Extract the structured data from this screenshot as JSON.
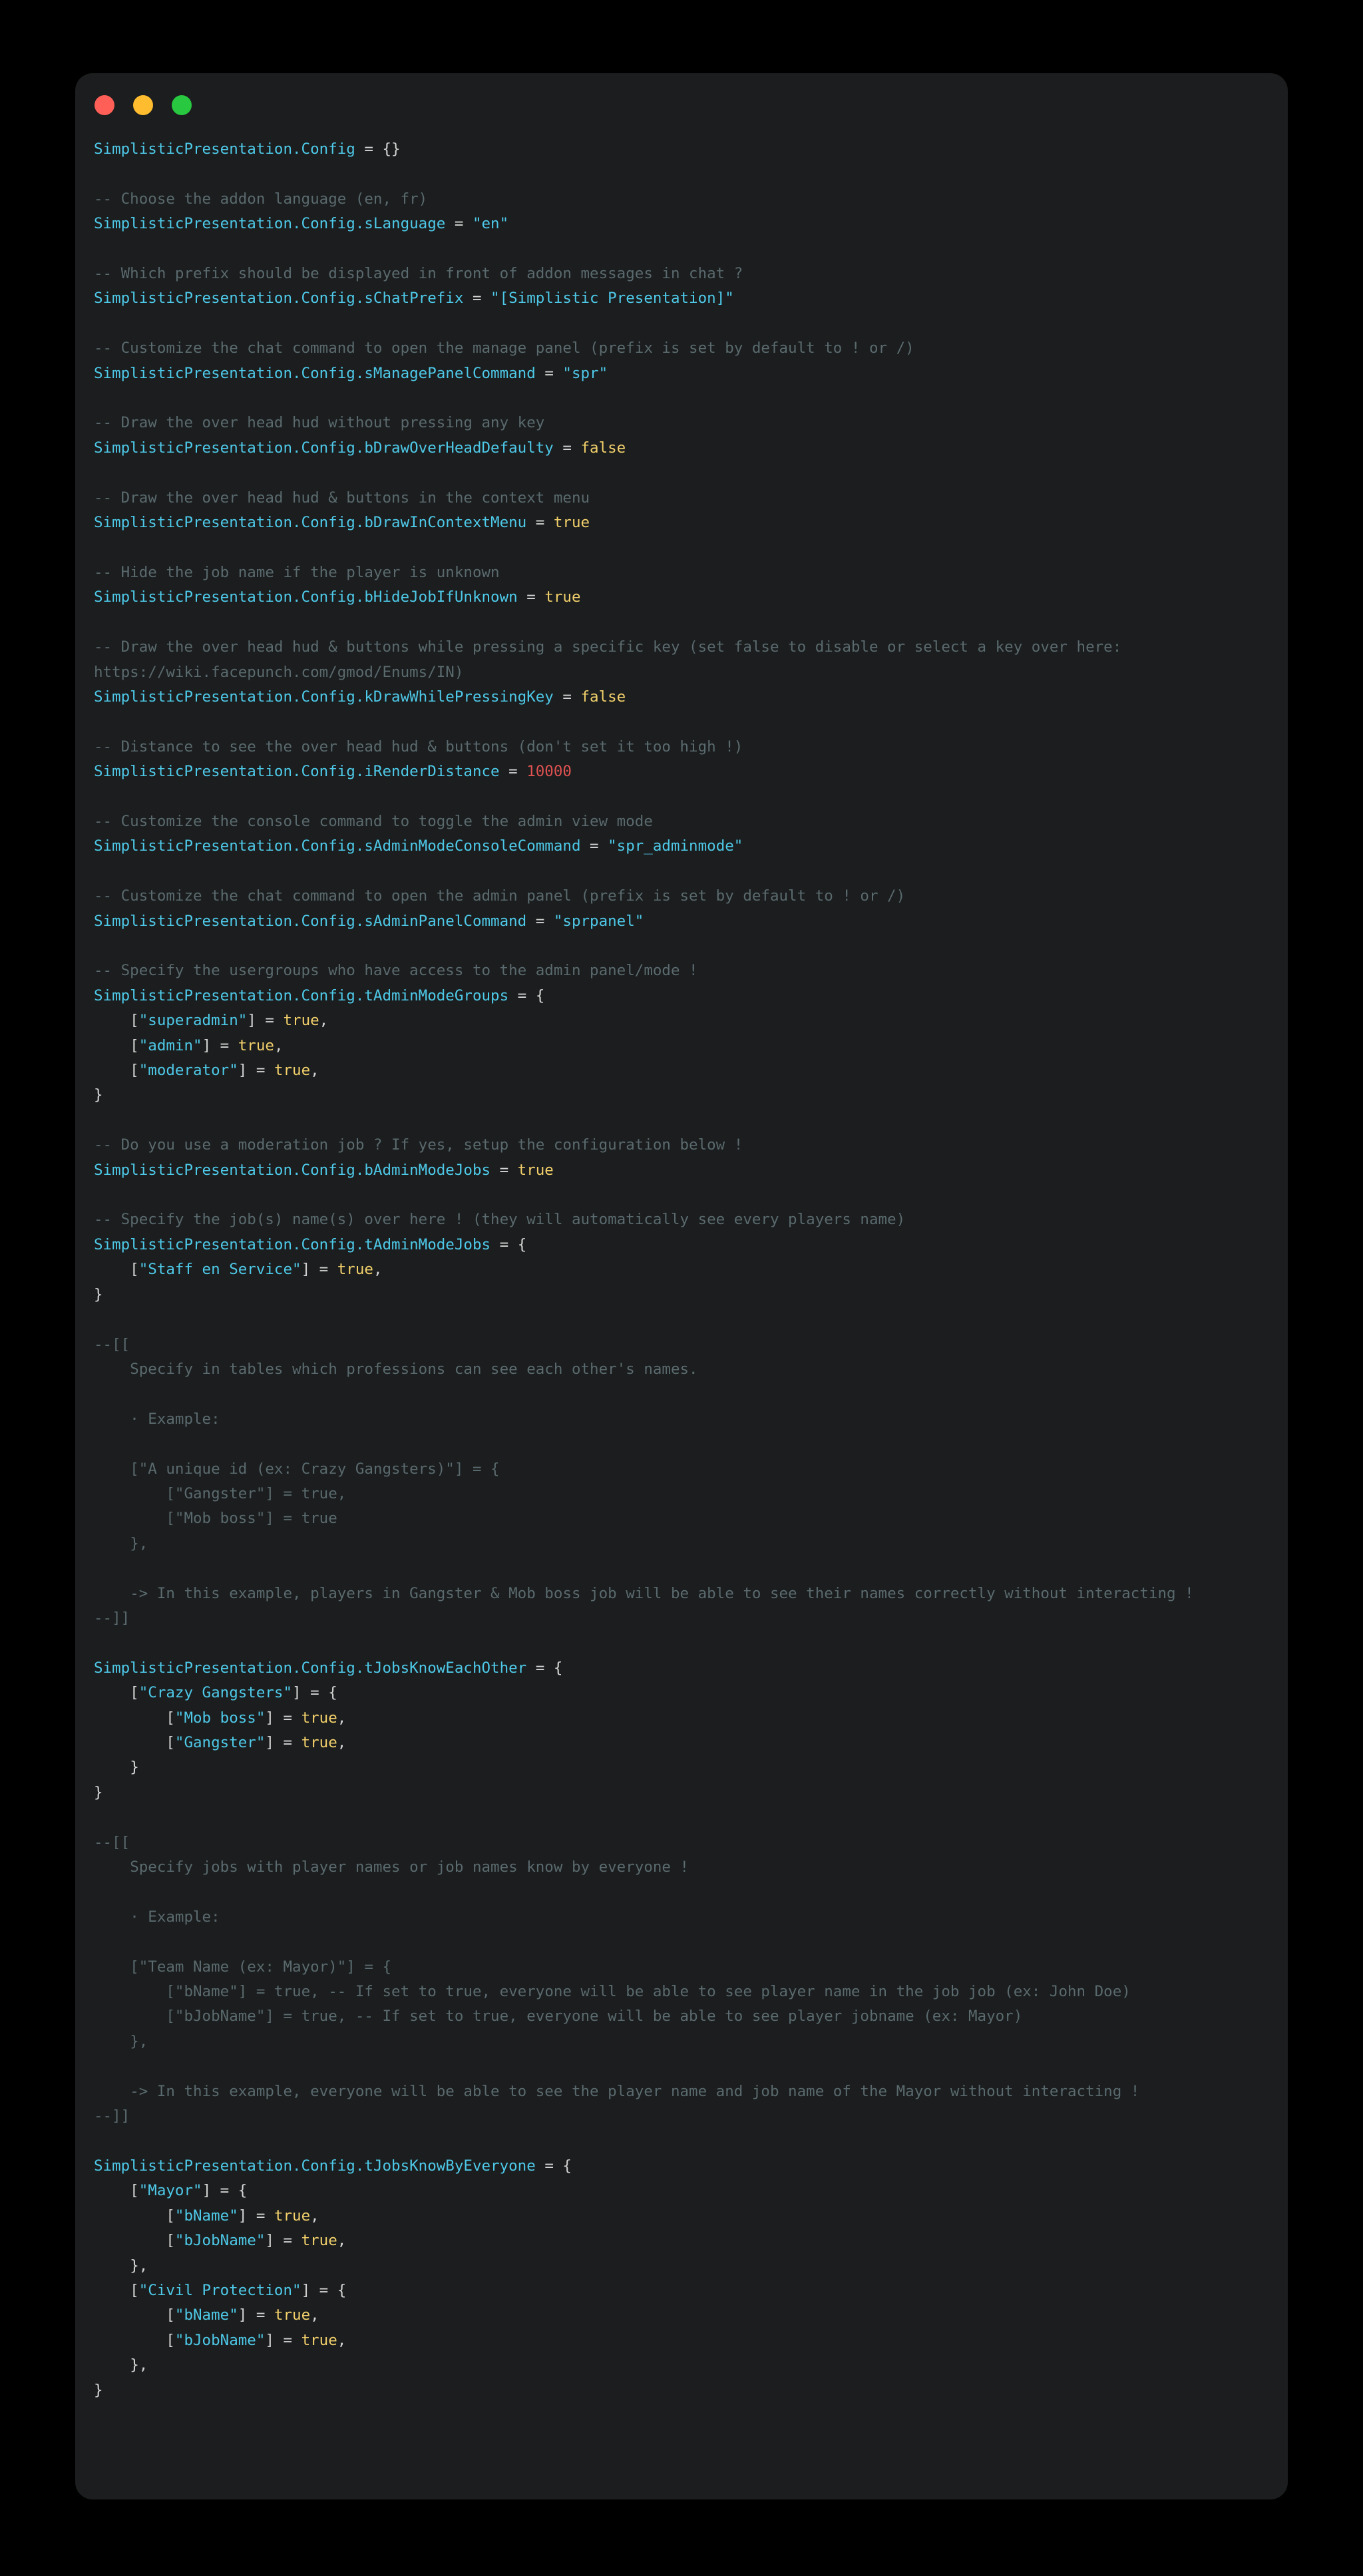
{
  "window": {
    "traffic_lights": [
      {
        "name": "close-button",
        "color": "#ff5f57"
      },
      {
        "name": "minimize-button",
        "color": "#febc2e"
      },
      {
        "name": "maximize-button",
        "color": "#28c840"
      }
    ],
    "background": "#1b1d1e",
    "page_background": "#000000"
  },
  "theme": {
    "identifier": "#4ec9e8",
    "string": "#4ec9e8",
    "boolean": "#f2d06b",
    "number": "#e05252",
    "punctuation": "#d4d4d4",
    "comment": "#5a6a6e"
  },
  "code": {
    "language": "lua",
    "lines": [
      [
        {
          "t": "ident",
          "v": "SimplisticPresentation.Config"
        },
        {
          "t": "plain",
          "v": " "
        },
        {
          "t": "op",
          "v": "="
        },
        {
          "t": "plain",
          "v": " "
        },
        {
          "t": "punct",
          "v": "{}"
        }
      ],
      [],
      [
        {
          "t": "comment",
          "v": "-- Choose the addon language (en, fr)"
        }
      ],
      [
        {
          "t": "ident",
          "v": "SimplisticPresentation.Config.sLanguage"
        },
        {
          "t": "plain",
          "v": " "
        },
        {
          "t": "op",
          "v": "="
        },
        {
          "t": "plain",
          "v": " "
        },
        {
          "t": "str",
          "v": "\"en\""
        }
      ],
      [],
      [
        {
          "t": "comment",
          "v": "-- Which prefix should be displayed in front of addon messages in chat ?"
        }
      ],
      [
        {
          "t": "ident",
          "v": "SimplisticPresentation.Config.sChatPrefix"
        },
        {
          "t": "plain",
          "v": " "
        },
        {
          "t": "op",
          "v": "="
        },
        {
          "t": "plain",
          "v": " "
        },
        {
          "t": "str",
          "v": "\"[Simplistic Presentation]\""
        }
      ],
      [],
      [
        {
          "t": "comment",
          "v": "-- Customize the chat command to open the manage panel (prefix is set by default to ! or /)"
        }
      ],
      [
        {
          "t": "ident",
          "v": "SimplisticPresentation.Config.sManagePanelCommand"
        },
        {
          "t": "plain",
          "v": " "
        },
        {
          "t": "op",
          "v": "="
        },
        {
          "t": "plain",
          "v": " "
        },
        {
          "t": "str",
          "v": "\"spr\""
        }
      ],
      [],
      [
        {
          "t": "comment",
          "v": "-- Draw the over head hud without pressing any key"
        }
      ],
      [
        {
          "t": "ident",
          "v": "SimplisticPresentation.Config.bDrawOverHeadDefaulty"
        },
        {
          "t": "plain",
          "v": " "
        },
        {
          "t": "op",
          "v": "="
        },
        {
          "t": "plain",
          "v": " "
        },
        {
          "t": "bool",
          "v": "false"
        }
      ],
      [],
      [
        {
          "t": "comment",
          "v": "-- Draw the over head hud & buttons in the context menu"
        }
      ],
      [
        {
          "t": "ident",
          "v": "SimplisticPresentation.Config.bDrawInContextMenu"
        },
        {
          "t": "plain",
          "v": " "
        },
        {
          "t": "op",
          "v": "="
        },
        {
          "t": "plain",
          "v": " "
        },
        {
          "t": "bool",
          "v": "true"
        }
      ],
      [],
      [
        {
          "t": "comment",
          "v": "-- Hide the job name if the player is unknown"
        }
      ],
      [
        {
          "t": "ident",
          "v": "SimplisticPresentation.Config.bHideJobIfUnknown"
        },
        {
          "t": "plain",
          "v": " "
        },
        {
          "t": "op",
          "v": "="
        },
        {
          "t": "plain",
          "v": " "
        },
        {
          "t": "bool",
          "v": "true"
        }
      ],
      [],
      [
        {
          "t": "comment",
          "v": "-- Draw the over head hud & buttons while pressing a specific key (set false to disable or select a key over here: https://wiki.facepunch.com/gmod/Enums/IN)"
        }
      ],
      [
        {
          "t": "ident",
          "v": "SimplisticPresentation.Config.kDrawWhilePressingKey"
        },
        {
          "t": "plain",
          "v": " "
        },
        {
          "t": "op",
          "v": "="
        },
        {
          "t": "plain",
          "v": " "
        },
        {
          "t": "bool",
          "v": "false"
        }
      ],
      [],
      [
        {
          "t": "comment",
          "v": "-- Distance to see the over head hud & buttons (don't set it too high !)"
        }
      ],
      [
        {
          "t": "ident",
          "v": "SimplisticPresentation.Config.iRenderDistance"
        },
        {
          "t": "plain",
          "v": " "
        },
        {
          "t": "op",
          "v": "="
        },
        {
          "t": "plain",
          "v": " "
        },
        {
          "t": "num",
          "v": "10000"
        }
      ],
      [],
      [
        {
          "t": "comment",
          "v": "-- Customize the console command to toggle the admin view mode"
        }
      ],
      [
        {
          "t": "ident",
          "v": "SimplisticPresentation.Config.sAdminModeConsoleCommand"
        },
        {
          "t": "plain",
          "v": " "
        },
        {
          "t": "op",
          "v": "="
        },
        {
          "t": "plain",
          "v": " "
        },
        {
          "t": "str",
          "v": "\"spr_adminmode\""
        }
      ],
      [],
      [
        {
          "t": "comment",
          "v": "-- Customize the chat command to open the admin panel (prefix is set by default to ! or /)"
        }
      ],
      [
        {
          "t": "ident",
          "v": "SimplisticPresentation.Config.sAdminPanelCommand"
        },
        {
          "t": "plain",
          "v": " "
        },
        {
          "t": "op",
          "v": "="
        },
        {
          "t": "plain",
          "v": " "
        },
        {
          "t": "str",
          "v": "\"sprpanel\""
        }
      ],
      [],
      [
        {
          "t": "comment",
          "v": "-- Specify the usergroups who have access to the admin panel/mode !"
        }
      ],
      [
        {
          "t": "ident",
          "v": "SimplisticPresentation.Config.tAdminModeGroups"
        },
        {
          "t": "plain",
          "v": " "
        },
        {
          "t": "op",
          "v": "="
        },
        {
          "t": "plain",
          "v": " "
        },
        {
          "t": "punct",
          "v": "{"
        }
      ],
      [
        {
          "t": "plain",
          "v": "    "
        },
        {
          "t": "punct",
          "v": "["
        },
        {
          "t": "str",
          "v": "\"superadmin\""
        },
        {
          "t": "punct",
          "v": "]"
        },
        {
          "t": "plain",
          "v": " "
        },
        {
          "t": "op",
          "v": "="
        },
        {
          "t": "plain",
          "v": " "
        },
        {
          "t": "bool",
          "v": "true"
        },
        {
          "t": "punct",
          "v": ","
        }
      ],
      [
        {
          "t": "plain",
          "v": "    "
        },
        {
          "t": "punct",
          "v": "["
        },
        {
          "t": "str",
          "v": "\"admin\""
        },
        {
          "t": "punct",
          "v": "]"
        },
        {
          "t": "plain",
          "v": " "
        },
        {
          "t": "op",
          "v": "="
        },
        {
          "t": "plain",
          "v": " "
        },
        {
          "t": "bool",
          "v": "true"
        },
        {
          "t": "punct",
          "v": ","
        }
      ],
      [
        {
          "t": "plain",
          "v": "    "
        },
        {
          "t": "punct",
          "v": "["
        },
        {
          "t": "str",
          "v": "\"moderator\""
        },
        {
          "t": "punct",
          "v": "]"
        },
        {
          "t": "plain",
          "v": " "
        },
        {
          "t": "op",
          "v": "="
        },
        {
          "t": "plain",
          "v": " "
        },
        {
          "t": "bool",
          "v": "true"
        },
        {
          "t": "punct",
          "v": ","
        }
      ],
      [
        {
          "t": "punct",
          "v": "}"
        }
      ],
      [],
      [
        {
          "t": "comment",
          "v": "-- Do you use a moderation job ? If yes, setup the configuration below !"
        }
      ],
      [
        {
          "t": "ident",
          "v": "SimplisticPresentation.Config.bAdminModeJobs"
        },
        {
          "t": "plain",
          "v": " "
        },
        {
          "t": "op",
          "v": "="
        },
        {
          "t": "plain",
          "v": " "
        },
        {
          "t": "bool",
          "v": "true"
        }
      ],
      [],
      [
        {
          "t": "comment",
          "v": "-- Specify the job(s) name(s) over here ! (they will automatically see every players name)"
        }
      ],
      [
        {
          "t": "ident",
          "v": "SimplisticPresentation.Config.tAdminModeJobs"
        },
        {
          "t": "plain",
          "v": " "
        },
        {
          "t": "op",
          "v": "="
        },
        {
          "t": "plain",
          "v": " "
        },
        {
          "t": "punct",
          "v": "{"
        }
      ],
      [
        {
          "t": "plain",
          "v": "    "
        },
        {
          "t": "punct",
          "v": "["
        },
        {
          "t": "str",
          "v": "\"Staff en Service\""
        },
        {
          "t": "punct",
          "v": "]"
        },
        {
          "t": "plain",
          "v": " "
        },
        {
          "t": "op",
          "v": "="
        },
        {
          "t": "plain",
          "v": " "
        },
        {
          "t": "bool",
          "v": "true"
        },
        {
          "t": "punct",
          "v": ","
        }
      ],
      [
        {
          "t": "punct",
          "v": "}"
        }
      ],
      [],
      [
        {
          "t": "comment",
          "v": "--[["
        }
      ],
      [
        {
          "t": "comment",
          "v": "    Specify in tables which professions can see each other's names."
        }
      ],
      [],
      [
        {
          "t": "comment",
          "v": "    · Example:"
        }
      ],
      [],
      [
        {
          "t": "comment",
          "v": "    [\"A unique id (ex: Crazy Gangsters)\"] = {"
        }
      ],
      [
        {
          "t": "comment",
          "v": "        [\"Gangster\"] = true,"
        }
      ],
      [
        {
          "t": "comment",
          "v": "        [\"Mob boss\"] = true"
        }
      ],
      [
        {
          "t": "comment",
          "v": "    },"
        }
      ],
      [],
      [
        {
          "t": "comment",
          "v": "    -> In this example, players in Gangster & Mob boss job will be able to see their names correctly without interacting !"
        }
      ],
      [
        {
          "t": "comment",
          "v": "--]]"
        }
      ],
      [],
      [
        {
          "t": "ident",
          "v": "SimplisticPresentation.Config.tJobsKnowEachOther"
        },
        {
          "t": "plain",
          "v": " "
        },
        {
          "t": "op",
          "v": "="
        },
        {
          "t": "plain",
          "v": " "
        },
        {
          "t": "punct",
          "v": "{"
        }
      ],
      [
        {
          "t": "plain",
          "v": "    "
        },
        {
          "t": "punct",
          "v": "["
        },
        {
          "t": "str",
          "v": "\"Crazy Gangsters\""
        },
        {
          "t": "punct",
          "v": "]"
        },
        {
          "t": "plain",
          "v": " "
        },
        {
          "t": "op",
          "v": "="
        },
        {
          "t": "plain",
          "v": " "
        },
        {
          "t": "punct",
          "v": "{"
        }
      ],
      [
        {
          "t": "plain",
          "v": "        "
        },
        {
          "t": "punct",
          "v": "["
        },
        {
          "t": "str",
          "v": "\"Mob boss\""
        },
        {
          "t": "punct",
          "v": "]"
        },
        {
          "t": "plain",
          "v": " "
        },
        {
          "t": "op",
          "v": "="
        },
        {
          "t": "plain",
          "v": " "
        },
        {
          "t": "bool",
          "v": "true"
        },
        {
          "t": "punct",
          "v": ","
        }
      ],
      [
        {
          "t": "plain",
          "v": "        "
        },
        {
          "t": "punct",
          "v": "["
        },
        {
          "t": "str",
          "v": "\"Gangster\""
        },
        {
          "t": "punct",
          "v": "]"
        },
        {
          "t": "plain",
          "v": " "
        },
        {
          "t": "op",
          "v": "="
        },
        {
          "t": "plain",
          "v": " "
        },
        {
          "t": "bool",
          "v": "true"
        },
        {
          "t": "punct",
          "v": ","
        }
      ],
      [
        {
          "t": "plain",
          "v": "    "
        },
        {
          "t": "punct",
          "v": "}"
        }
      ],
      [
        {
          "t": "punct",
          "v": "}"
        }
      ],
      [],
      [
        {
          "t": "comment",
          "v": "--[["
        }
      ],
      [
        {
          "t": "comment",
          "v": "    Specify jobs with player names or job names know by everyone !"
        }
      ],
      [],
      [
        {
          "t": "comment",
          "v": "    · Example:"
        }
      ],
      [],
      [
        {
          "t": "comment",
          "v": "    [\"Team Name (ex: Mayor)\"] = {"
        }
      ],
      [
        {
          "t": "comment",
          "v": "        [\"bName\"] = true, -- If set to true, everyone will be able to see player name in the job job (ex: John Doe)"
        }
      ],
      [
        {
          "t": "comment",
          "v": "        [\"bJobName\"] = true, -- If set to true, everyone will be able to see player jobname (ex: Mayor)"
        }
      ],
      [
        {
          "t": "comment",
          "v": "    },"
        }
      ],
      [],
      [
        {
          "t": "comment",
          "v": "    -> In this example, everyone will be able to see the player name and job name of the Mayor without interacting !"
        }
      ],
      [
        {
          "t": "comment",
          "v": "--]]"
        }
      ],
      [],
      [
        {
          "t": "ident",
          "v": "SimplisticPresentation.Config.tJobsKnowByEveryone"
        },
        {
          "t": "plain",
          "v": " "
        },
        {
          "t": "op",
          "v": "="
        },
        {
          "t": "plain",
          "v": " "
        },
        {
          "t": "punct",
          "v": "{"
        }
      ],
      [
        {
          "t": "plain",
          "v": "    "
        },
        {
          "t": "punct",
          "v": "["
        },
        {
          "t": "str",
          "v": "\"Mayor\""
        },
        {
          "t": "punct",
          "v": "]"
        },
        {
          "t": "plain",
          "v": " "
        },
        {
          "t": "op",
          "v": "="
        },
        {
          "t": "plain",
          "v": " "
        },
        {
          "t": "punct",
          "v": "{"
        }
      ],
      [
        {
          "t": "plain",
          "v": "        "
        },
        {
          "t": "punct",
          "v": "["
        },
        {
          "t": "str",
          "v": "\"bName\""
        },
        {
          "t": "punct",
          "v": "]"
        },
        {
          "t": "plain",
          "v": " "
        },
        {
          "t": "op",
          "v": "="
        },
        {
          "t": "plain",
          "v": " "
        },
        {
          "t": "bool",
          "v": "true"
        },
        {
          "t": "punct",
          "v": ","
        }
      ],
      [
        {
          "t": "plain",
          "v": "        "
        },
        {
          "t": "punct",
          "v": "["
        },
        {
          "t": "str",
          "v": "\"bJobName\""
        },
        {
          "t": "punct",
          "v": "]"
        },
        {
          "t": "plain",
          "v": " "
        },
        {
          "t": "op",
          "v": "="
        },
        {
          "t": "plain",
          "v": " "
        },
        {
          "t": "bool",
          "v": "true"
        },
        {
          "t": "punct",
          "v": ","
        }
      ],
      [
        {
          "t": "plain",
          "v": "    "
        },
        {
          "t": "punct",
          "v": "},"
        }
      ],
      [
        {
          "t": "plain",
          "v": "    "
        },
        {
          "t": "punct",
          "v": "["
        },
        {
          "t": "str",
          "v": "\"Civil Protection\""
        },
        {
          "t": "punct",
          "v": "]"
        },
        {
          "t": "plain",
          "v": " "
        },
        {
          "t": "op",
          "v": "="
        },
        {
          "t": "plain",
          "v": " "
        },
        {
          "t": "punct",
          "v": "{"
        }
      ],
      [
        {
          "t": "plain",
          "v": "        "
        },
        {
          "t": "punct",
          "v": "["
        },
        {
          "t": "str",
          "v": "\"bName\""
        },
        {
          "t": "punct",
          "v": "]"
        },
        {
          "t": "plain",
          "v": " "
        },
        {
          "t": "op",
          "v": "="
        },
        {
          "t": "plain",
          "v": " "
        },
        {
          "t": "bool",
          "v": "true"
        },
        {
          "t": "punct",
          "v": ","
        }
      ],
      [
        {
          "t": "plain",
          "v": "        "
        },
        {
          "t": "punct",
          "v": "["
        },
        {
          "t": "str",
          "v": "\"bJobName\""
        },
        {
          "t": "punct",
          "v": "]"
        },
        {
          "t": "plain",
          "v": " "
        },
        {
          "t": "op",
          "v": "="
        },
        {
          "t": "plain",
          "v": " "
        },
        {
          "t": "bool",
          "v": "true"
        },
        {
          "t": "punct",
          "v": ","
        }
      ],
      [
        {
          "t": "plain",
          "v": "    "
        },
        {
          "t": "punct",
          "v": "},"
        }
      ],
      [
        {
          "t": "punct",
          "v": "}"
        }
      ]
    ]
  }
}
